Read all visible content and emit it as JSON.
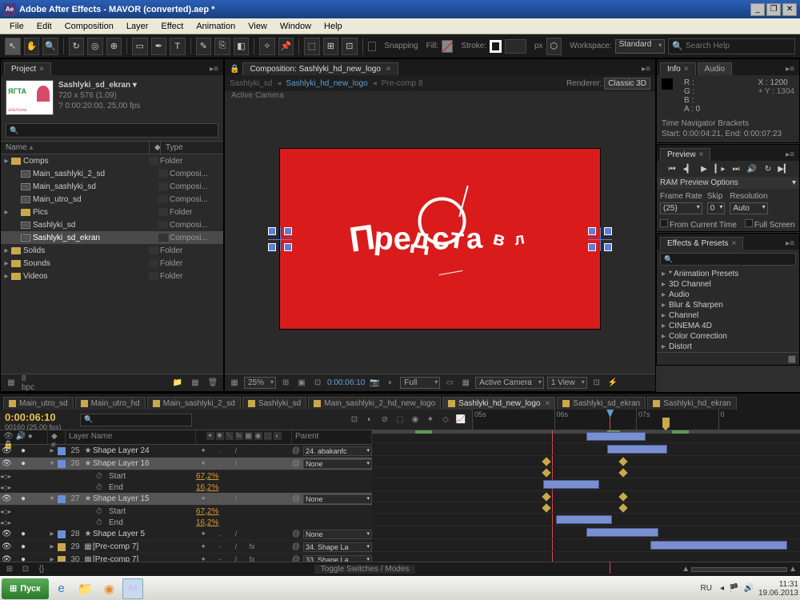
{
  "app": {
    "title": "Adobe After Effects - MAVOR (converted).aep *",
    "logo_text": "Ae"
  },
  "menu": [
    "File",
    "Edit",
    "Composition",
    "Layer",
    "Effect",
    "Animation",
    "View",
    "Window",
    "Help"
  ],
  "toolbar": {
    "snapping": "Snapping",
    "fill": "Fill:",
    "stroke": "Stroke:",
    "stroke_px": "px",
    "workspace_label": "Workspace:",
    "workspace_value": "Standard",
    "search_placeholder": "Search Help"
  },
  "project": {
    "tab": "Project",
    "item_name": "Sashlyki_sd_ekran ▾",
    "dims": "720 x 576 (1,09)",
    "dur": "? 0:00:20:00, 25,00 fps",
    "col_name": "Name",
    "col_type": "Type",
    "items": [
      {
        "tw": "▸",
        "icon": "folder",
        "name": "Comps",
        "type": "Folder",
        "indent": 0
      },
      {
        "tw": "",
        "icon": "comp",
        "name": "Main_sashlyki_2_sd",
        "type": "Composi...",
        "indent": 1
      },
      {
        "tw": "",
        "icon": "comp",
        "name": "Main_sashlyki_sd",
        "type": "Composi...",
        "indent": 1
      },
      {
        "tw": "",
        "icon": "comp",
        "name": "Main_utro_sd",
        "type": "Composi...",
        "indent": 1
      },
      {
        "tw": "▸",
        "icon": "folder",
        "name": "Pics",
        "type": "Folder",
        "indent": 1
      },
      {
        "tw": "",
        "icon": "comp",
        "name": "Sashlyki_sd",
        "type": "Composi...",
        "indent": 1
      },
      {
        "tw": "",
        "icon": "comp",
        "name": "Sashlyki_sd_ekran",
        "type": "Composi...",
        "indent": 1,
        "sel": true
      },
      {
        "tw": "▸",
        "icon": "folder",
        "name": "Solids",
        "type": "Folder",
        "indent": 0
      },
      {
        "tw": "▸",
        "icon": "folder",
        "name": "Sounds",
        "type": "Folder",
        "indent": 0
      },
      {
        "tw": "▸",
        "icon": "folder",
        "name": "Videos",
        "type": "Folder",
        "indent": 0
      }
    ],
    "bpc": "8 bpc"
  },
  "comp": {
    "tab_prefix": "Composition:",
    "tab_name": "Sashlyki_hd_new_logo",
    "crumbs": [
      "Sashlyki_sd",
      "Sashlyki_hd_new_logo",
      "Pre-comp 8"
    ],
    "renderer_label": "Renderer:",
    "renderer_value": "Classic 3D",
    "active_cam": "Active Camera",
    "anim_text": "Предста",
    "foot": {
      "zoom": "25%",
      "time": "0:00:06:10",
      "quality": "Full",
      "camera": "Active Camera",
      "views": "1 View"
    }
  },
  "info": {
    "tab": "Info",
    "tab2": "Audio",
    "r": "R :",
    "g": "G :",
    "b": "B :",
    "a": "A : 0",
    "x": "X : 1200",
    "y": "Y : 1304",
    "status1": "Time Navigator Brackets",
    "status2": "Start: 0:00:04:21, End: 0:00:07:23"
  },
  "preview": {
    "tab": "Preview",
    "ram_header": "RAM Preview Options",
    "frame_rate": "Frame Rate",
    "fr_val": "(25)",
    "skip": "Skip",
    "skip_val": "0",
    "resolution": "Resolution",
    "res_val": "Auto",
    "from_current": "From Current Time",
    "full_screen": "Full Screen"
  },
  "effects": {
    "tab": "Effects & Presets",
    "items": [
      "* Animation Presets",
      "3D Channel",
      "Audio",
      "Blur & Sharpen",
      "Channel",
      "CINEMA 4D",
      "Color Correction",
      "Distort"
    ]
  },
  "timeline": {
    "tabs": [
      "Main_utro_sd",
      "Main_utro_hd",
      "Main_sashlyki_2_sd",
      "Sashlyki_sd",
      "Main_sashlyki_2_hd_new_logo",
      "Sashlyki_hd_new_logo",
      "Sashlyki_sd_ekran",
      "Sashlyki_hd_ekran"
    ],
    "active_tab": 5,
    "time": "0:00:06:10",
    "time_sub": "00160 (25.00 fps)",
    "ruler": [
      "05s",
      "06s",
      "07s",
      "0"
    ],
    "col_layer": "Layer Name",
    "col_parent": "Parent",
    "layers": [
      {
        "num": "25",
        "name": "Shape Layer 24",
        "color": "#6a8fd9",
        "parent": "24. abakanfc",
        "tw": "▸"
      },
      {
        "num": "26",
        "name": "Shape Layer 16",
        "color": "#6a8fd9",
        "parent": "None",
        "tw": "▾",
        "sel": true,
        "props": [
          {
            "name": "Start",
            "val": "67,2%"
          },
          {
            "name": "End",
            "val": "16,2%"
          }
        ]
      },
      {
        "num": "27",
        "name": "Shape Layer 15",
        "color": "#6a8fd9",
        "parent": "None",
        "tw": "▾",
        "sel": true,
        "props": [
          {
            "name": "Start",
            "val": "67,2%"
          },
          {
            "name": "End",
            "val": "16,2%"
          }
        ]
      },
      {
        "num": "28",
        "name": "Shape Layer 5",
        "color": "#6a8fd9",
        "parent": "None",
        "tw": "▸"
      },
      {
        "num": "29",
        "name": "[Pre-comp 7]",
        "color": "#c9a94a",
        "parent": "34. Shape La",
        "tw": "▸",
        "comp": true
      },
      {
        "num": "30",
        "name": "[Pre-comp 7]",
        "color": "#c9a94a",
        "parent": "33. Shape La",
        "tw": "▸",
        "comp": true
      }
    ],
    "toggle": "Toggle Switches / Modes"
  },
  "taskbar": {
    "start": "Пуск",
    "lang": "RU",
    "time": "11:31",
    "date": "19.06.2013"
  }
}
